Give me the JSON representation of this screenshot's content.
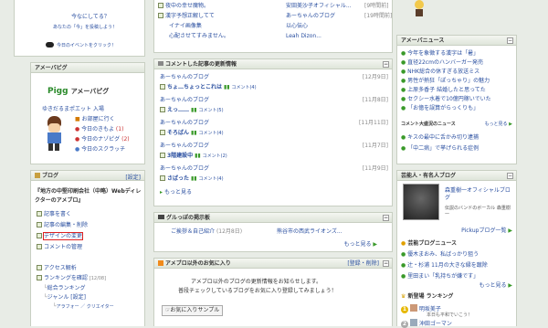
{
  "top_left": {
    "question": "今なにしてる？",
    "sub": "あなたの「今」を投稿しよう！",
    "daily": "今日のイベントをクリック！"
  },
  "top_center": {
    "rows": [
      {
        "title": "夜中の幸せ魔物。",
        "who": "安田美沙子オフィシャル...",
        "date": "[9時間前]"
      },
      {
        "title": "漢字予想正解してて",
        "who": "あーちゃんのブログ",
        "date": "[19時間前]"
      },
      {
        "title": "イナイ画像集",
        "who": "以心伝心",
        "date": ""
      },
      {
        "title": "心配させてすみません。",
        "who": "Leah Dizon...",
        "date": ""
      }
    ]
  },
  "amepiga": {
    "header": "アメーバピグ",
    "logo_pigg": "Pigg",
    "logo_text": "アメーバピグ",
    "user_link": "ゆきだるまポエット 入場",
    "links": [
      {
        "label": "お部屋に行く",
        "count": ""
      },
      {
        "label": "今日のきもよ",
        "count": "(1)"
      },
      {
        "label": "今日のナゾピグ",
        "count": "(2)"
      },
      {
        "label": "今日のスクラッチ",
        "count": ""
      }
    ]
  },
  "blog": {
    "header": "ブログ",
    "setting": "[設定]",
    "blog_title": "『地方の中堅印刷会社（中略）Webディレクターのアメブロ』",
    "items": [
      "記事を書く",
      "記事の編集・削除",
      "デザインの変更",
      "コメントの管理"
    ],
    "access_title": "アクセス解析",
    "ranking": "ランキングを確認",
    "ranking_date": "[12/08]",
    "sub": [
      "総合ランキング",
      "ジャンル [設定]",
      "アラフォー ／ クリエイター"
    ]
  },
  "comments": {
    "header": "コメントした記事の更新情報",
    "entries": [
      {
        "blog": "あーちゃんのブログ",
        "date": "[12月9日]",
        "title": "ちょ…ちょっとこれは",
        "comment": "コメント(4)"
      },
      {
        "blog": "あーちゃんのブログ",
        "date": "[11月8日]",
        "title": "えっ……",
        "comment": "コメント(5)"
      },
      {
        "blog": "あーちゃんのブログ",
        "date": "[11月11日]",
        "title": "そろばん",
        "comment": "コメント(4)"
      },
      {
        "blog": "あーちゃんのブログ",
        "date": "[11月7日]",
        "title": "3階建設中",
        "comment": "コメント(2)"
      },
      {
        "blog": "あーちゃんのブログ",
        "date": "[11月9日]",
        "title": "さばった",
        "comment": "コメント(4)"
      }
    ],
    "more": "もっと見る"
  },
  "groups": {
    "header": "グルっぽの掲示板",
    "topic": "ご挨拶＆自己紹介",
    "date": "(12月8日)",
    "group": "熊谷市の西武ライオンズ...",
    "more": "もっと見る"
  },
  "other_fav": {
    "header": "アメブロ以外のお気に入り",
    "action": "[登録・削除]",
    "line1": "アメブロ以外のブログの更新情報をお知らせします。",
    "line2": "普段チェックしているブログをお気に入り登録してみましょう！",
    "sample": "お気に入りサンプル"
  },
  "news": {
    "header": "アメーバニュース",
    "items": [
      "今年を象徴する漢字は「暑」",
      "直径22cmのハンバーガー発売",
      "NHK総合の休すぎる放送ミス",
      "男性が熱狂「ぽっちゃり」の魅力",
      "上原多香子 結婚したと思ってた",
      "セクシー水着で10億円稼いでいた",
      "「お億を誤算がらっくりも」"
    ],
    "popular_title": "コメント大盛況のニュース",
    "popular_more": "もっと見る",
    "popular": [
      "キスの最中に舌かみ切り逮捕",
      "「中二病」で挙げられる症例"
    ]
  },
  "celebrity": {
    "header": "芸能人・有名人ブログ",
    "name": "森重樹一オフィシャルブログ",
    "desc": "伝説のバンドのボーカル 森重樹一",
    "more": "Pickupブログ一覧",
    "news_title": "芸能ブログニュース",
    "news": [
      "優木まおみ、私ばっかり狙う",
      "辻・杉浦 11月の大きな縁を蹴除",
      "里田まい「乳持ちが嫌です」"
    ],
    "news_more": "もっと見る",
    "rank_title": "新登場 ランキング",
    "rank": [
      {
        "n": "1",
        "name": "明坂美子",
        "sub": "本日も平和でいこう！"
      },
      {
        "n": "2",
        "name": "沖田ゴーマン",
        "sub": ""
      }
    ]
  }
}
